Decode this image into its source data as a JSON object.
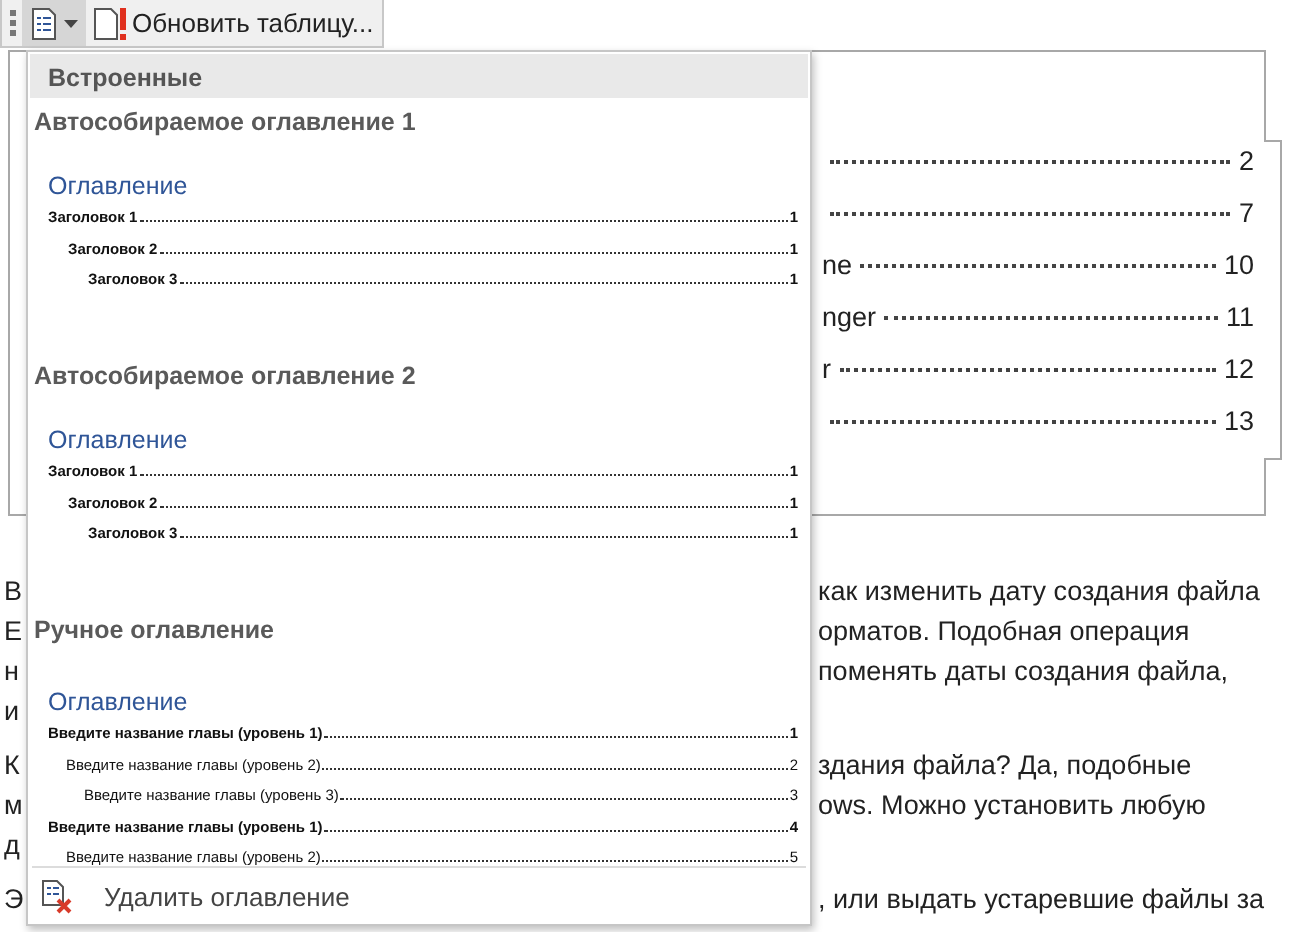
{
  "toolbar": {
    "toc_button": {
      "selected": true
    },
    "update_button": {
      "label": "Обновить таблицу..."
    }
  },
  "document": {
    "toc_lines": [
      {
        "page": "2"
      },
      {
        "page": "7"
      },
      {
        "tail": "ne",
        "page": "10"
      },
      {
        "tail": "nger",
        "page": "11"
      },
      {
        "tail": "r",
        "page": "12"
      },
      {
        "page": "13"
      }
    ],
    "paragraphs": [
      [
        {
          "left": "В",
          "right": "как изменить дату создания файла"
        },
        {
          "left": "Е",
          "right": "орматов. Подобная операция"
        },
        {
          "left": "н",
          "right": "поменять даты создания файла,"
        },
        {
          "left": "и"
        }
      ],
      [
        {
          "left": "К",
          "right": "здания файла? Да, подобные"
        },
        {
          "left": "м",
          "right": "ows. Можно установить любую"
        },
        {
          "left": "д"
        }
      ],
      [
        {
          "left": "Э",
          "right": ", или выдать устаревшие файлы за"
        }
      ]
    ]
  },
  "menu": {
    "header": "Встроенные",
    "sections": [
      {
        "kind": "auto",
        "title": "Автособираемое оглавление 1",
        "preview": {
          "heading": "Оглавление",
          "entries": [
            {
              "text": "Заголовок 1",
              "page": "1",
              "children": [
                {
                  "text": "Заголовок 2",
                  "page": "1",
                  "children": [
                    {
                      "text": "Заголовок 3",
                      "page": "1"
                    }
                  ]
                }
              ]
            }
          ]
        }
      },
      {
        "kind": "auto",
        "title": "Автособираемое оглавление 2",
        "preview": {
          "heading": "Оглавление",
          "entries": [
            {
              "text": "Заголовок 1",
              "page": "1",
              "children": [
                {
                  "text": "Заголовок 2",
                  "page": "1",
                  "children": [
                    {
                      "text": "Заголовок 3",
                      "page": "1"
                    }
                  ]
                }
              ]
            }
          ]
        }
      },
      {
        "kind": "manual",
        "title": "Ручное оглавление",
        "preview": {
          "heading": "Оглавление",
          "entries": [
            {
              "text": "Введите название главы (уровень 1)",
              "page": "1",
              "children": [
                {
                  "text": "Введите название главы (уровень 2)",
                  "page": "2",
                  "children": [
                    {
                      "text": "Введите название главы (уровень 3)",
                      "page": "3"
                    }
                  ]
                }
              ]
            },
            {
              "text": "Введите название главы (уровень 1)",
              "page": "4",
              "children": [
                {
                  "text": "Введите название главы (уровень 2)",
                  "page": "5"
                }
              ]
            }
          ]
        }
      }
    ],
    "footer": {
      "label": "Удалить оглавление"
    }
  }
}
